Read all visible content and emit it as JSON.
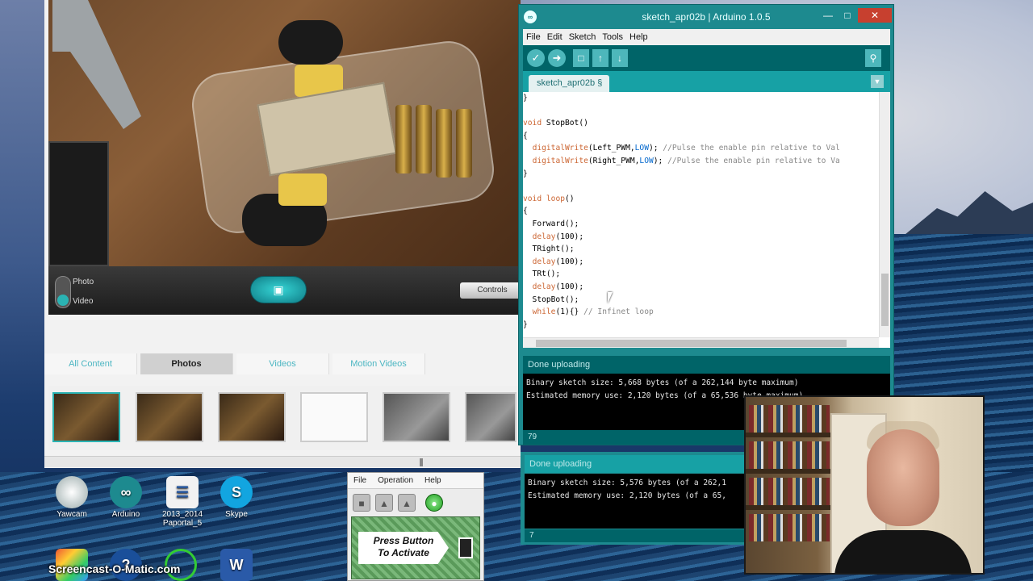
{
  "camera_app": {
    "mode_photo": "Photo",
    "mode_video": "Video",
    "controls_button": "Controls",
    "tabs": [
      {
        "label": "All Content"
      },
      {
        "label": "Photos"
      },
      {
        "label": "Videos"
      },
      {
        "label": "Motion Videos"
      }
    ]
  },
  "desktop_icons": [
    {
      "label": "Yawcam"
    },
    {
      "label": "Arduino"
    },
    {
      "label": "2013_2014 Paportal_5"
    },
    {
      "label": "Skype"
    }
  ],
  "ide": {
    "title": "sketch_apr02b | Arduino 1.0.5",
    "menu": [
      "File",
      "Edit",
      "Sketch",
      "Tools",
      "Help"
    ],
    "tab": "sketch_apr02b §",
    "code_lines": [
      "}",
      "",
      "void StopBot()",
      "{",
      "  digitalWrite(Left_PWM,LOW); //Pulse the enable pin relative to Val",
      "  digitalWrite(Right_PWM,LOW); //Pulse the enable pin relative to Va",
      "}",
      "",
      "void loop()",
      "{",
      "  Forward();",
      "  delay(100);",
      "  TRight();",
      "  delay(100);",
      "  TRt();",
      "  delay(100);",
      "  StopBot();",
      "  while(1){} // Infinet loop",
      "}"
    ],
    "status": "Done uploading",
    "console_lines": [
      "Binary sketch size: 5,668 bytes (of a 262,144 byte maximum)",
      "Estimated memory use: 2,120 bytes (of a 65,536 byte maximum)"
    ],
    "line_number": "79"
  },
  "ide2": {
    "status": "Done uploading",
    "console_lines": [
      "Binary sketch size: 5,576 bytes (of a 262,1",
      "Estimated memory use: 2,120 bytes (of a 65,"
    ],
    "line_number": "7"
  },
  "util_app": {
    "menu": [
      "File",
      "Operation",
      "Help"
    ],
    "banner_line1": "Press Button",
    "banner_line2": "To Activate"
  },
  "watermark": "Screencast-O-Matic.com"
}
